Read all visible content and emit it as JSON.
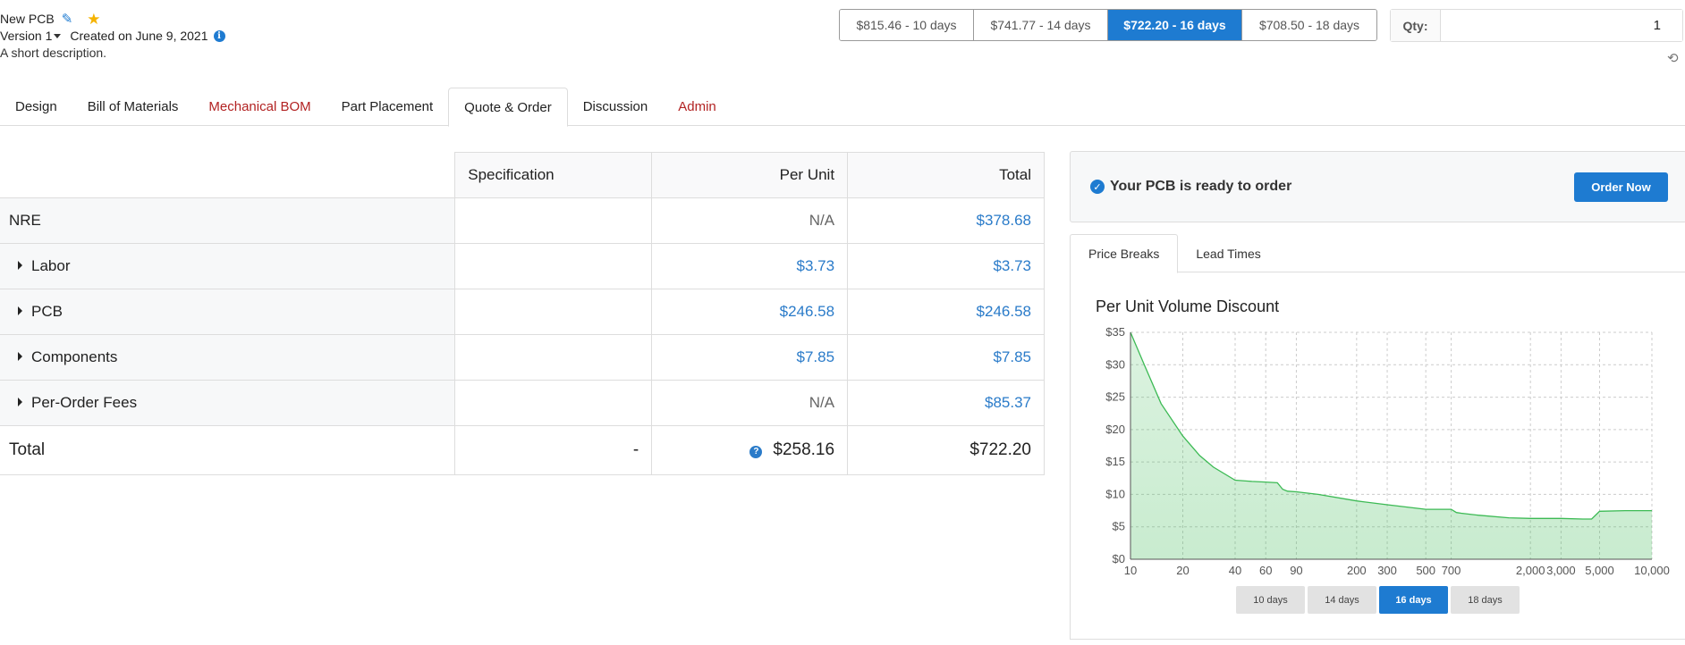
{
  "header": {
    "title": "New PCB",
    "version_label": "Version",
    "version_number": "1",
    "created": "Created on June 9, 2021",
    "description": "A short description."
  },
  "lead_time_prices": [
    {
      "label": "$815.46 - 10 days",
      "active": false
    },
    {
      "label": "$741.77 - 14 days",
      "active": false
    },
    {
      "label": "$722.20 - 16 days",
      "active": true
    },
    {
      "label": "$708.50 - 18 days",
      "active": false
    }
  ],
  "qty": {
    "label": "Qty:",
    "value": "1"
  },
  "tabs": [
    {
      "label": "Design",
      "style": "normal"
    },
    {
      "label": "Bill of Materials",
      "style": "normal"
    },
    {
      "label": "Mechanical BOM",
      "style": "red"
    },
    {
      "label": "Part Placement",
      "style": "normal"
    },
    {
      "label": "Quote & Order",
      "style": "active"
    },
    {
      "label": "Discussion",
      "style": "normal"
    },
    {
      "label": "Admin",
      "style": "red"
    }
  ],
  "cost_table": {
    "headers": {
      "spec": "Specification",
      "per_unit": "Per Unit",
      "total": "Total"
    },
    "rows": [
      {
        "label": "NRE",
        "expandable": false,
        "spec": "",
        "per_unit": "N/A",
        "per_unit_na": true,
        "total": "$378.68"
      },
      {
        "label": "Labor",
        "expandable": true,
        "spec": "",
        "per_unit": "$3.73",
        "per_unit_na": false,
        "total": "$3.73"
      },
      {
        "label": "PCB",
        "expandable": true,
        "spec": "",
        "per_unit": "$246.58",
        "per_unit_na": false,
        "total": "$246.58"
      },
      {
        "label": "Components",
        "expandable": true,
        "spec": "",
        "per_unit": "$7.85",
        "per_unit_na": false,
        "total": "$7.85"
      },
      {
        "label": "Per-Order Fees",
        "expandable": true,
        "spec": "",
        "per_unit": "N/A",
        "per_unit_na": true,
        "total": "$85.37"
      }
    ],
    "total_row": {
      "label": "Total",
      "spec": "-",
      "per_unit": "$258.16",
      "total": "$722.20"
    }
  },
  "ready": {
    "text": "Your PCB is ready to order",
    "button": "Order Now"
  },
  "panel_tabs": [
    {
      "label": "Price Breaks",
      "active": true
    },
    {
      "label": "Lead Times",
      "active": false
    }
  ],
  "chart_title": "Per Unit Volume Discount",
  "chart_data": {
    "type": "area",
    "title": "Per Unit Volume Discount",
    "x_scale": "log",
    "x_ticks": [
      10,
      20,
      40,
      60,
      90,
      200,
      300,
      500,
      700,
      2000,
      3000,
      5000,
      10000
    ],
    "x_tick_labels": [
      "10",
      "20",
      "40",
      "60",
      "90",
      "200",
      "300",
      "500",
      "700",
      "2,000",
      "3,000",
      "5,000",
      "10,000"
    ],
    "y_ticks": [
      0,
      5,
      10,
      15,
      20,
      25,
      30,
      35
    ],
    "y_tick_labels": [
      "$0",
      "$5",
      "$10",
      "$15",
      "$20",
      "$25",
      "$30",
      "$35"
    ],
    "ylim": [
      0,
      35
    ],
    "xlim": [
      10,
      10000
    ],
    "grid": true,
    "color": "#3cba54",
    "x": [
      10,
      12,
      15,
      20,
      25,
      30,
      40,
      50,
      60,
      70,
      75,
      80,
      90,
      120,
      200,
      300,
      500,
      700,
      750,
      800,
      1000,
      1500,
      2000,
      3000,
      4000,
      4500,
      5000,
      7000,
      10000
    ],
    "y": [
      35,
      30,
      24,
      19,
      16,
      14.2,
      12.2,
      12,
      11.9,
      11.8,
      10.8,
      10.5,
      10.4,
      10,
      9,
      8.4,
      7.7,
      7.7,
      7.2,
      7.1,
      6.8,
      6.4,
      6.3,
      6.3,
      6.2,
      6.2,
      7.4,
      7.5,
      7.5
    ]
  },
  "chart_lead_buttons": [
    {
      "label": "10 days",
      "active": false
    },
    {
      "label": "14 days",
      "active": false
    },
    {
      "label": "16 days",
      "active": true
    },
    {
      "label": "18 days",
      "active": false
    }
  ]
}
